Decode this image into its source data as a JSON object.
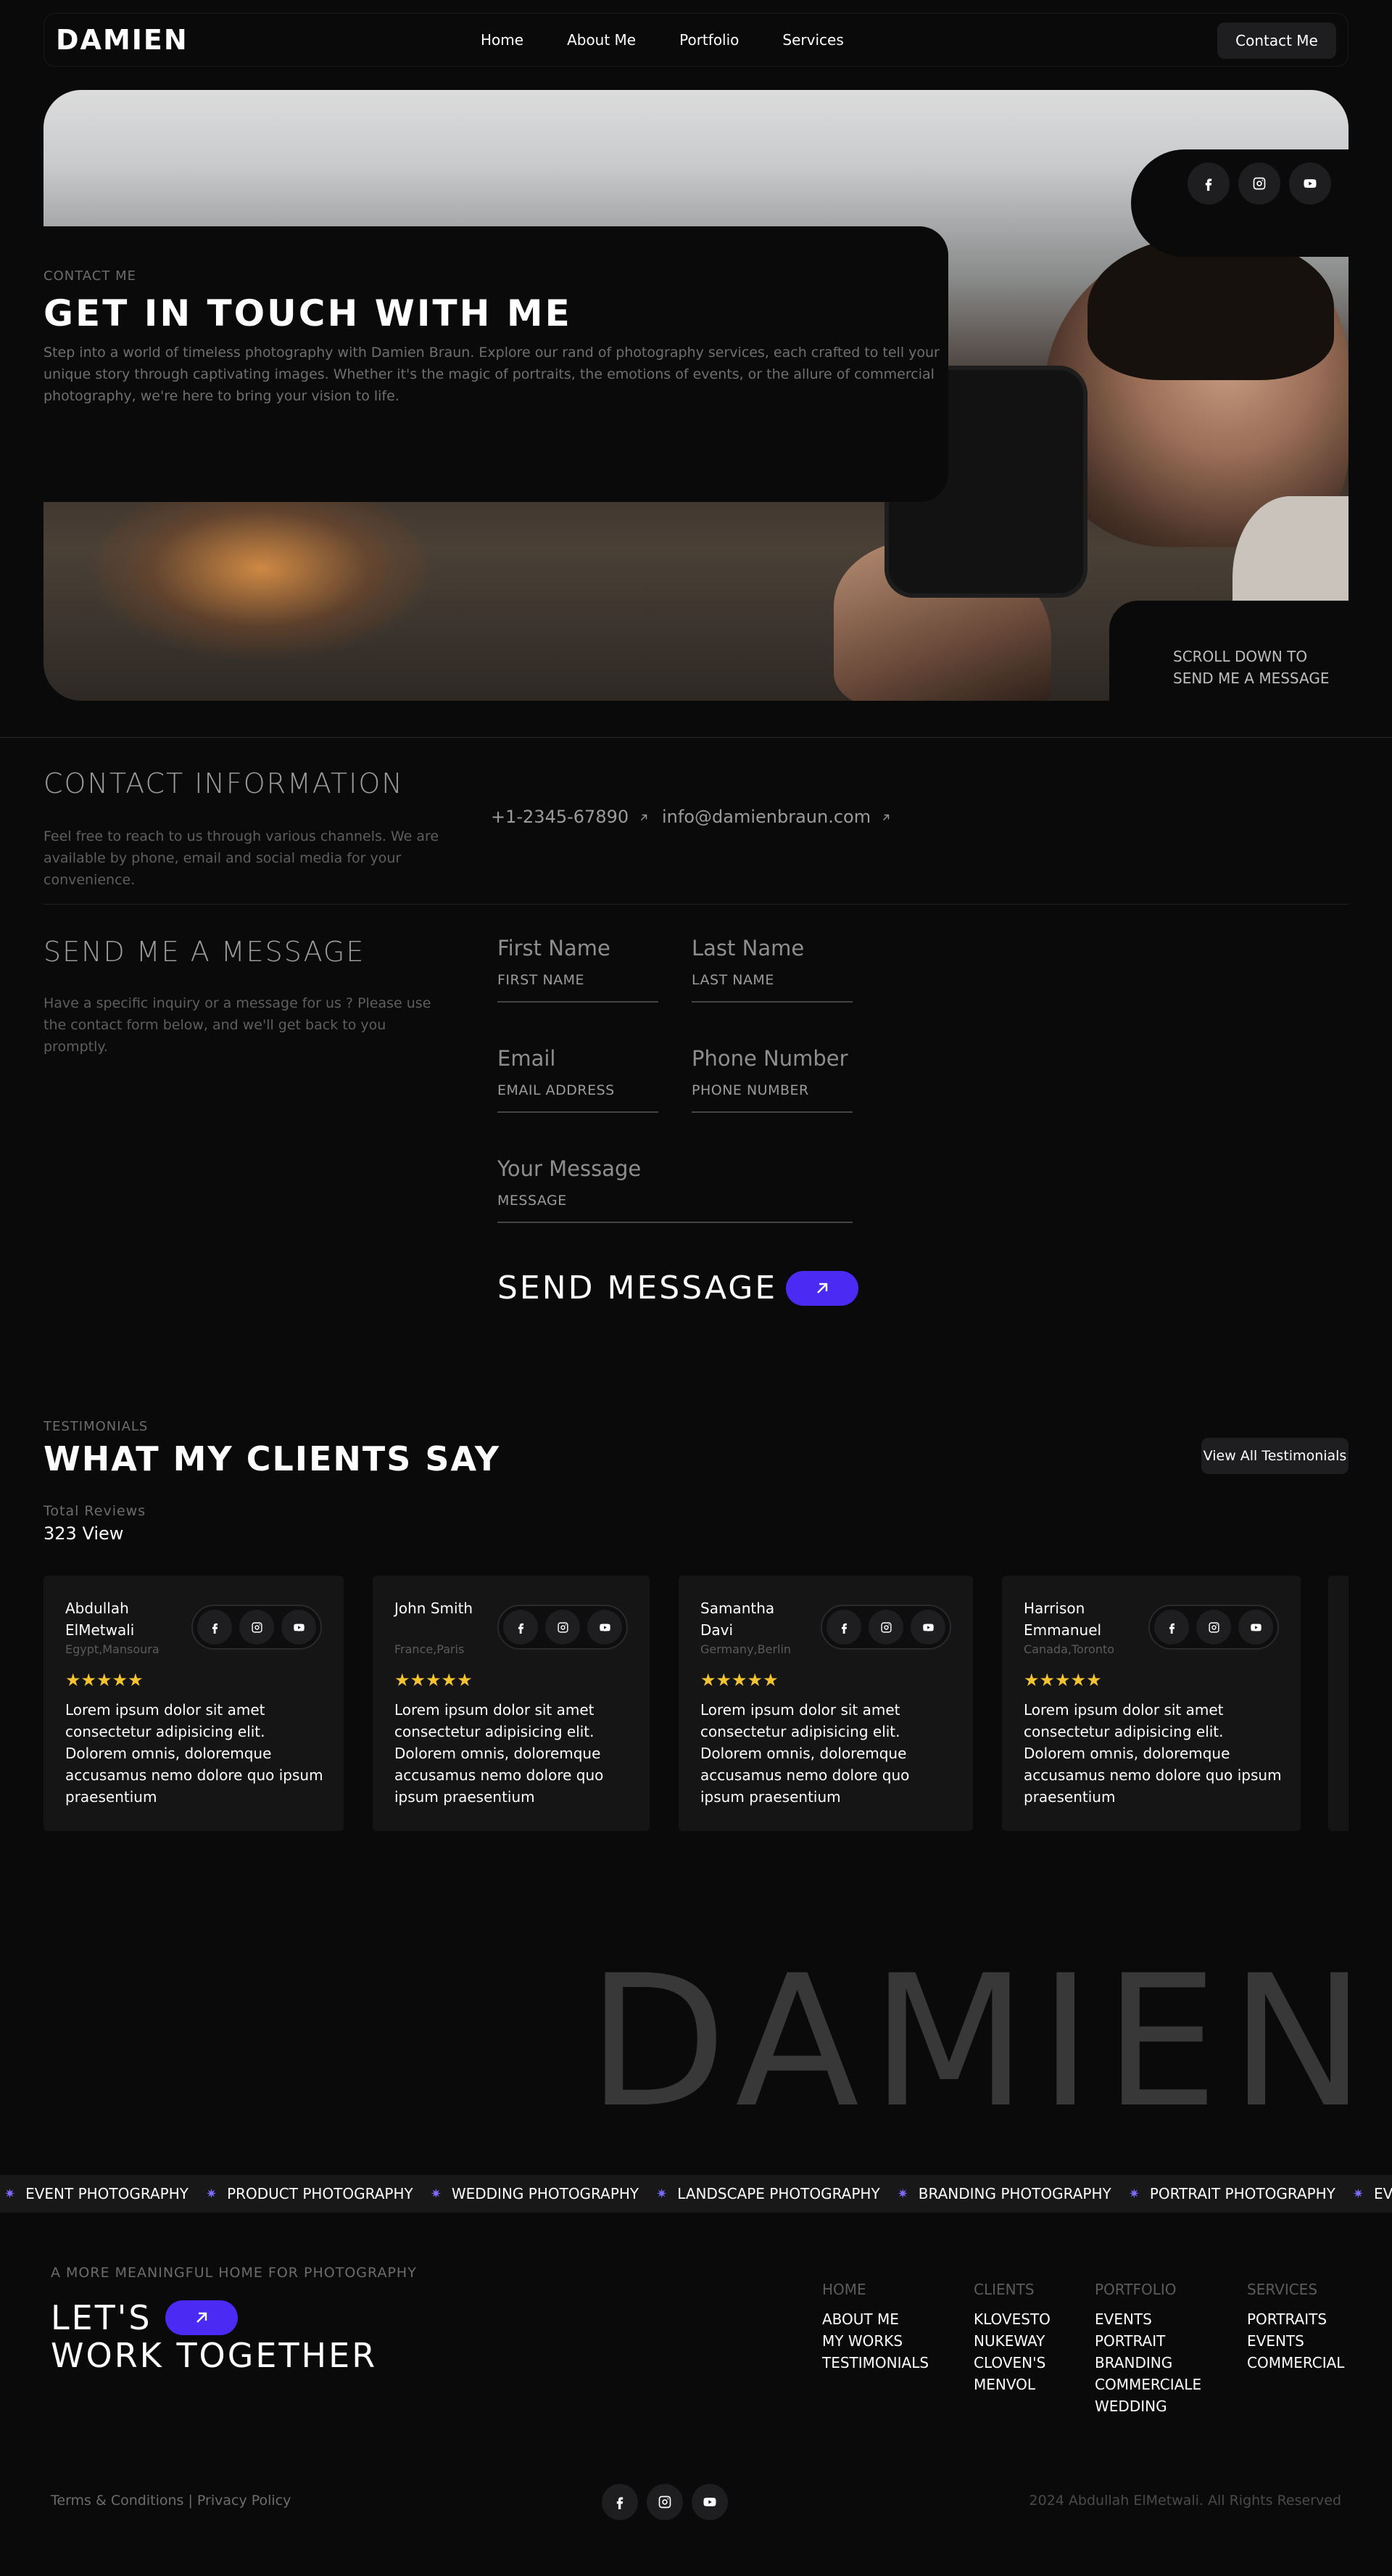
{
  "header": {
    "logo": "DAMIEN",
    "nav": [
      "Home",
      "About Me",
      "Portfolio",
      "Services"
    ],
    "cta": "Contact Me"
  },
  "hero": {
    "eyebrow": "CONTACT ME",
    "title": "GET IN TOUCH WITH ME",
    "description": "Step into a world of timeless photography with Damien Braun. Explore our rand of photography services, each crafted to tell your unique story through captivating images. Whether it's the magic of portraits, the emotions of events, or the allure of commercial photography, we're here to bring your vision to life.",
    "scroll_hint": "SCROLL DOWN TO SEND ME A MESSAGE",
    "social_icons": [
      "facebook-icon",
      "instagram-icon",
      "youtube-icon"
    ]
  },
  "contact_info": {
    "title": "CONTACT INFORMATION",
    "description": "Feel free to reach to us through various channels. We are available by phone, email and social media for your convenience.",
    "phone": "+1-2345-67890",
    "email": "info@damienbraun.com"
  },
  "message": {
    "title": "SEND ME A MESSAGE",
    "description": "Have a specific inquiry or a message for us ? Please use the contact form below, and we'll get back to you promptly.",
    "fields": {
      "first_name": {
        "label": "First Name",
        "placeholder": "FIRST NAME"
      },
      "last_name": {
        "label": "Last Name",
        "placeholder": "LAST NAME"
      },
      "email": {
        "label": "Email",
        "placeholder": "EMAIL ADDRESS"
      },
      "phone": {
        "label": "Phone Number",
        "placeholder": "PHONE NUMBER"
      },
      "message": {
        "label": "Your Message",
        "placeholder": "MESSAGE"
      }
    },
    "submit": "SEND MESSAGE",
    "accent": "#4b2af3"
  },
  "testimonials": {
    "eyebrow": "TESTIMONIALS",
    "title": "WHAT MY CLIENTS SAY",
    "view_all": "View All Testimonials",
    "total_label": "Total Reviews",
    "total_value": "323 View",
    "cards": [
      {
        "name": "Abdullah ElMetwali",
        "location": "Egypt,Mansoura",
        "stars": "★★★★★",
        "text": "Lorem ipsum dolor sit amet consectetur adipisicing elit. Dolorem omnis, doloremque accusamus nemo dolore quo ipsum praesentium"
      },
      {
        "name": "John Smith",
        "location": "France,Paris",
        "stars": "★★★★★",
        "text": "Lorem ipsum dolor sit amet consectetur adipisicing elit. Dolorem omnis, doloremque accusamus nemo dolore quo ipsum praesentium"
      },
      {
        "name": "Samantha Davi",
        "location": "Germany,Berlin",
        "stars": "★★★★★",
        "text": "Lorem ipsum dolor sit amet consectetur adipisicing elit. Dolorem omnis, doloremque accusamus nemo dolore quo ipsum praesentium"
      },
      {
        "name": "Harrison Emmanuel",
        "location": "Canada,Toronto",
        "stars": "★★★★★",
        "text": "Lorem ipsum dolor sit amet consectetur adipisicing elit. Dolorem omnis, doloremque accusamus nemo dolore quo ipsum praesentium"
      }
    ],
    "star_color": "#f4c430"
  },
  "brand_watermark": "DAMIEN",
  "marquee": [
    "EVENT PHOTOGRAPHY",
    "PRODUCT PHOTOGRAPHY",
    "WEDDING PHOTOGRAPHY",
    "LANDSCAPE PHOTOGRAPHY",
    "BRANDING PHOTOGRAPHY",
    "PORTRAIT PHOTOGRAPHY",
    "EVENT PHOTOGRAPHY"
  ],
  "footer": {
    "eyebrow": "A MORE MEANINGFUL HOME FOR PHOTOGRAPHY",
    "cta_line1": "LET'S",
    "cta_line2": "WORK TOGETHER",
    "columns": [
      {
        "heading": "HOME",
        "items": [
          "ABOUT ME",
          "MY WORKS",
          "TESTIMONIALS"
        ]
      },
      {
        "heading": "CLIENTS",
        "items": [
          "KLOVESTO",
          "NUKEWAY",
          "CLOVEN'S",
          "MENVOL"
        ]
      },
      {
        "heading": "PORTFOLIO",
        "items": [
          "EVENTS",
          "PORTRAIT",
          "BRANDING",
          "COMMERCIALE",
          "WEDDING"
        ]
      },
      {
        "heading": "SERVICES",
        "items": [
          "PORTRAITS",
          "EVENTS",
          "COMMERCIAL"
        ]
      }
    ],
    "legal": "Terms & Conditions | Privacy Policy",
    "copyright": "2024 Abdullah ElMetwali. All Rights Reserved"
  }
}
